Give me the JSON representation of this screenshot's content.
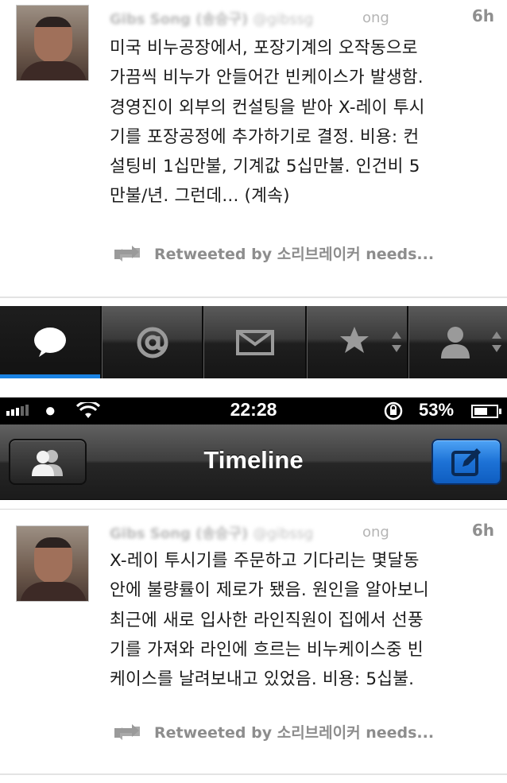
{
  "tweets": [
    {
      "author_name": "Gibs Song (송승구)",
      "handle_prefix": "@gibssg",
      "handle_suffix": "ong",
      "time": "6h",
      "text": "미국 비누공장에서, 포장기계의 오작동으로\n가끔씩 비누가 안들어간 빈케이스가 발생함.\n경영진이 외부의 컨설팅을 받아 X-레이 투시\n기를 포장공정에 추가하기로 결정. 비용: 컨\n설팅비 1십만불, 기계값 5십만불. 인건비 5\n만불/년. 그런데... (계속)",
      "retweet_label": "Retweeted by 소리브레이커 needs..."
    },
    {
      "author_name": "Gibs Song (송승구)",
      "handle_prefix": "@gibssg",
      "handle_suffix": "ong",
      "time": "6h",
      "text": "X-레이 투시기를 주문하고 기다리는 몇달동\n안에 불량률이 제로가 됐음. 원인을 알아보니\n최근에 새로 입사한 라인직원이 집에서 선풍\n기를 가져와 라인에 흐르는 비누케이스중 빈\n케이스를 날려보내고 있었음.  비용: 5십불.",
      "retweet_label": "Retweeted by 소리브레이커 needs..."
    }
  ],
  "tabbar": {
    "tabs": [
      {
        "icon": "speech-bubble-icon",
        "active": true
      },
      {
        "icon": "at-sign-icon",
        "active": false
      },
      {
        "icon": "envelope-icon",
        "active": false
      },
      {
        "icon": "star-icon",
        "active": false
      },
      {
        "icon": "person-icon",
        "active": false
      }
    ],
    "active_color": "#1a82e2"
  },
  "statusbar": {
    "time": "22:28",
    "battery": "53%",
    "battery_level": 0.53
  },
  "navbar": {
    "title": "Timeline",
    "left_icon": "accounts-icon",
    "right_icon": "compose-icon",
    "compose_color": "#1d72d6"
  }
}
